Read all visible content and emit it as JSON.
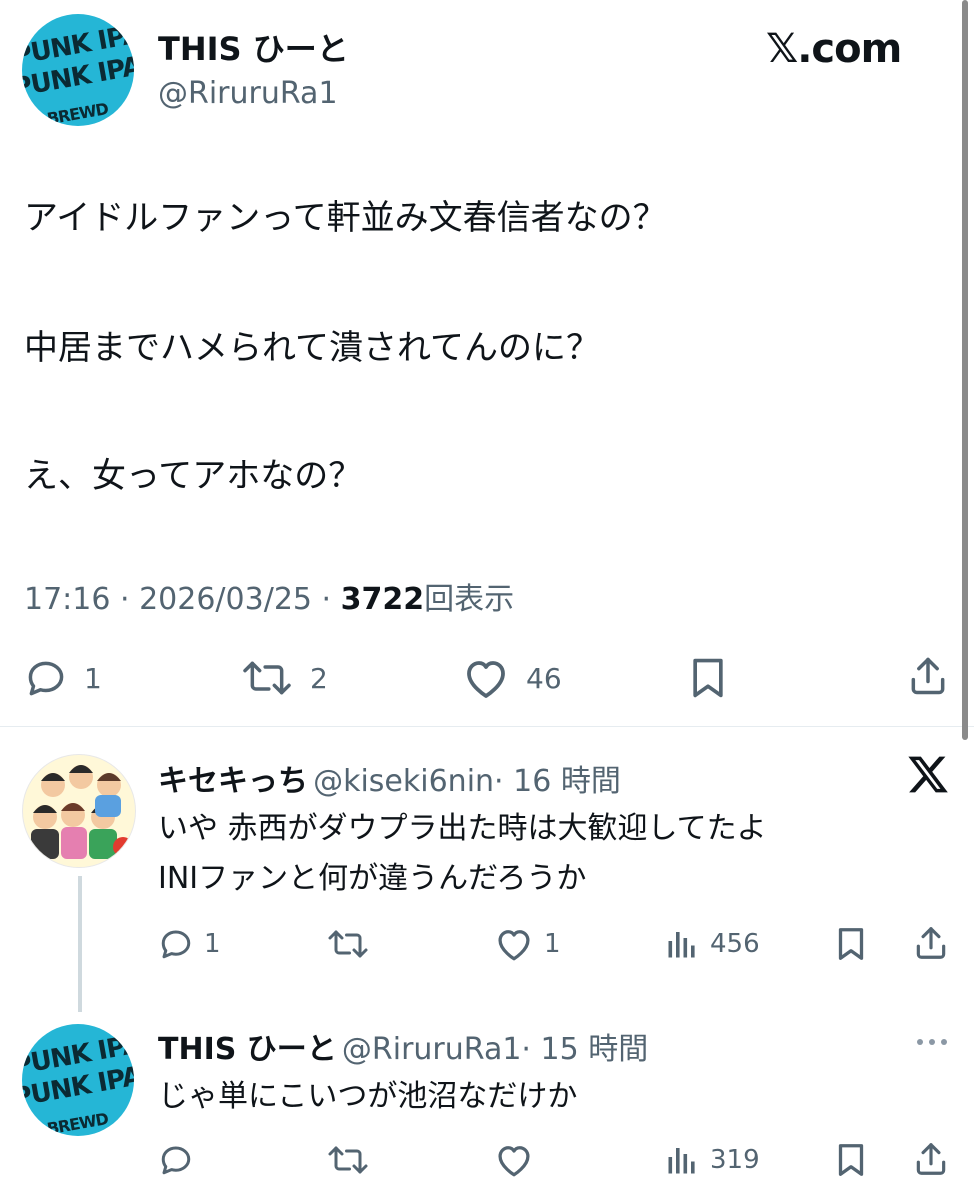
{
  "main_tweet": {
    "display_name": "THIS ひーと",
    "handle": "@RiruruRa1",
    "source_logo": "𝕏.com",
    "lines": [
      "アイドルファンって軒並み文春信者なの？",
      "中居までハメられて潰されてんのに？",
      "え、女ってアホなの？"
    ],
    "time": "17:16",
    "date": "2026/03/25",
    "views_count": "3722",
    "views_label": "回表示",
    "sep": " · ",
    "replies": "1",
    "retweets": "2",
    "likes": "46",
    "avatar_text": [
      "PUNK IPA",
      "PUNK IPA",
      "BREWD"
    ]
  },
  "replies": [
    {
      "display_name": "キセキっち",
      "handle": "@kiseki6nin",
      "time": "· 16 時間",
      "lines": [
        "いや 赤西がダウプラ出た時は大歓迎してたよ",
        "INIファンと何が違うんだろうか"
      ],
      "reply_count": "1",
      "like_count": "1",
      "views": "456",
      "corner_icon": "x-logo"
    },
    {
      "display_name": "THIS ひーと",
      "handle": "@RiruruRa1",
      "time": "· 15 時間",
      "lines": [
        "じゃ単にこいつが池沼なだけか"
      ],
      "views": "319",
      "corner_icon": "more-dots"
    }
  ],
  "colors": {
    "muted": "#536471",
    "text": "#0f1419",
    "avatar_bg": "#25b6d6",
    "divider": "#e6ecf0"
  },
  "icons": [
    "reply-icon",
    "retweet-icon",
    "like-icon",
    "bookmark-icon",
    "share-icon",
    "views-icon",
    "x-logo-icon",
    "more-icon"
  ]
}
